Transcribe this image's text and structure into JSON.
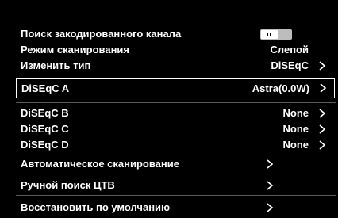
{
  "menu": {
    "items": [
      {
        "label": "Поиск закодированного канала",
        "value": "",
        "control": "toggle",
        "toggle_on": false
      },
      {
        "label": "Режим сканирования",
        "value": "Слепой"
      },
      {
        "label": "Изменить тип",
        "value": "DiSEqC"
      },
      {
        "label": "DiSEqC A",
        "value": "Astra(0.0W)"
      },
      {
        "label": "DiSEqC B",
        "value": "None"
      },
      {
        "label": "DiSEqC C",
        "value": "None"
      },
      {
        "label": "DiSEqC D",
        "value": "None"
      },
      {
        "label": "Автоматическое сканирование",
        "value": ""
      },
      {
        "label": "Ручной поиск ЦТВ",
        "value": ""
      },
      {
        "label": "Восстановить по умолчанию",
        "value": ""
      }
    ],
    "selected_index": 3
  },
  "icons": {
    "arrow": "chevron-right-icon"
  },
  "colors": {
    "background": "#000000",
    "text": "#ffffff",
    "selection_border": "#ffffff"
  }
}
